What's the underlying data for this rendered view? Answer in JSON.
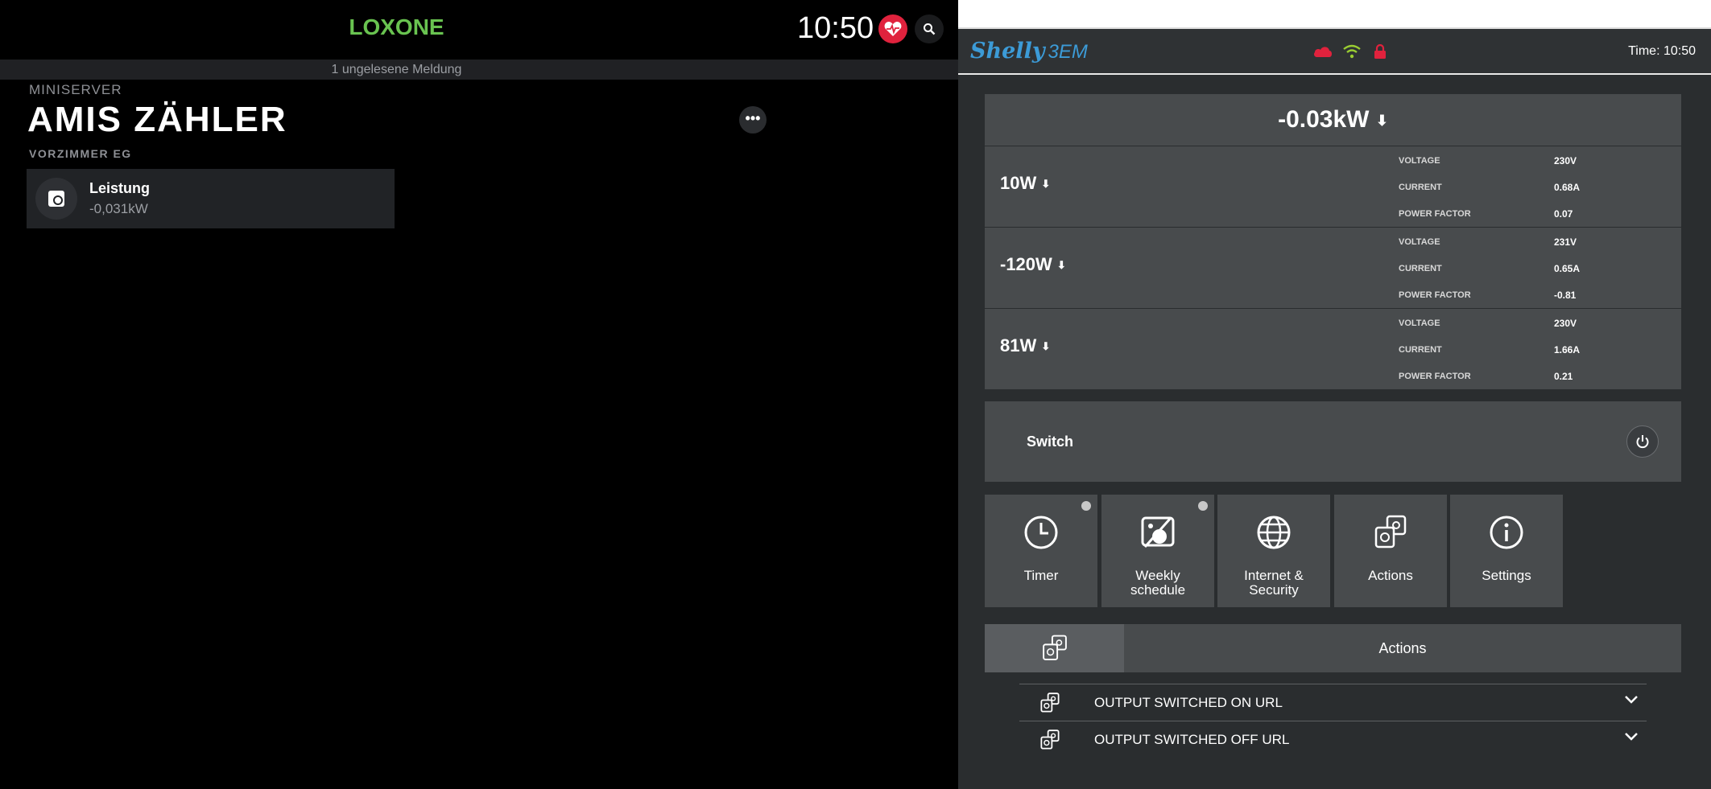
{
  "loxone": {
    "brand": "LOXONE",
    "clock": "10:50",
    "notice": "1 ungelesene Meldung",
    "breadcrumb": "MINISERVER",
    "title": "AMIS ZÄHLER",
    "room": "VORZIMMER EG",
    "more": "•••",
    "tile": {
      "label": "Leistung",
      "value": "-0,031kW"
    },
    "icons": [
      "heart-monitor-icon",
      "search-icon",
      "meter-icon"
    ]
  },
  "shelly": {
    "logo": "Shelly",
    "model": "3EM",
    "time": "Time: 10:50",
    "status_icons": [
      "cloud-icon",
      "wifi-icon",
      "lock-icon"
    ],
    "colors": {
      "brand": "#3c9bd7",
      "cloud": "#e0223d",
      "wifi": "#9acd32",
      "lock": "#e0223d"
    },
    "total_power": "-0.03kW",
    "phases": [
      {
        "power": "10W",
        "voltage": "230V",
        "current": "0.68A",
        "power_factor": "0.07"
      },
      {
        "power": "-120W",
        "voltage": "231V",
        "current": "0.65A",
        "power_factor": "-0.81"
      },
      {
        "power": "81W",
        "voltage": "230V",
        "current": "1.66A",
        "power_factor": "0.21"
      }
    ],
    "labels": {
      "voltage": "VOLTAGE",
      "current": "CURRENT",
      "power_factor": "POWER FACTOR"
    },
    "switch_label": "Switch",
    "tiles": [
      {
        "label": "Timer",
        "icon": "clock-icon"
      },
      {
        "label": "Weekly schedule",
        "icon": "weekly-schedule-icon"
      },
      {
        "label": "Internet & Security",
        "icon": "globe-icon"
      },
      {
        "label": "Actions",
        "icon": "actions-icon"
      },
      {
        "label": "Settings",
        "icon": "info-icon"
      }
    ],
    "actions_header": "Actions",
    "action_rows": [
      {
        "label": "OUTPUT SWITCHED ON URL"
      },
      {
        "label": "OUTPUT SWITCHED OFF URL"
      }
    ]
  }
}
